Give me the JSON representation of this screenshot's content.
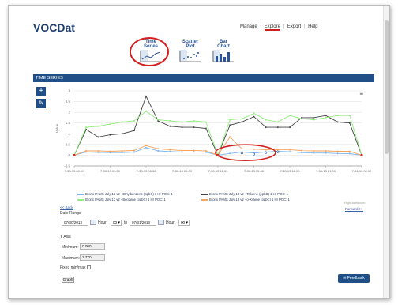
{
  "app": {
    "title": "VOCDat"
  },
  "nav": {
    "items": [
      {
        "label": "Manage",
        "active": false
      },
      {
        "label": "Explore",
        "active": true
      },
      {
        "label": "Export",
        "active": false
      },
      {
        "label": "Help",
        "active": false
      }
    ]
  },
  "views": [
    {
      "label_line1": "Time",
      "label_line2": "Series",
      "icon": "line-chart-icon",
      "selected": true
    },
    {
      "label_line1": "Scatter",
      "label_line2": "Plot",
      "icon": "scatter-plot-icon",
      "selected": false
    },
    {
      "label_line1": "Bar",
      "label_line2": "Chart",
      "icon": "bar-chart-icon",
      "selected": false
    }
  ],
  "section": {
    "title": "TIME SERIES"
  },
  "tools": {
    "add": "+",
    "edit": "✎",
    "menu": "≡"
  },
  "colors": {
    "navy": "#1f4f86",
    "highlight": "#d42020"
  },
  "chart_data": {
    "type": "line",
    "title": "",
    "xlabel": "",
    "ylabel": "Value",
    "ylim": [
      -0.5,
      3
    ],
    "yticks": [
      "3",
      "2.5",
      "2",
      "1.5",
      "1",
      "0.5",
      "0",
      "-0.5"
    ],
    "xticks": [
      "7-30-13 00:00",
      "7-30-13 03:00",
      "7-30-13 06:00",
      "7-30-13 09:00",
      "7-30-13 12:00",
      "7-30-13 15:00",
      "7-30-13 18:00",
      "7-30-13 21:00",
      "7-31-13 00:00"
    ],
    "xlim": [
      0,
      24
    ],
    "grid": true,
    "series": [
      {
        "name": "Bronx PAMS July 13 v2 - Ethylbenzene (ppbC) 1 Hr POC: 1",
        "color": "#7cb5ec",
        "points": [
          [
            0,
            0
          ],
          [
            1,
            0.15
          ],
          [
            2,
            0.13
          ],
          [
            3,
            0.12
          ],
          [
            4,
            0.12
          ],
          [
            5,
            0.14
          ],
          [
            6,
            0.35
          ],
          [
            7,
            0.2
          ],
          [
            8,
            0.17
          ],
          [
            9,
            0.15
          ],
          [
            10,
            0.15
          ],
          [
            11,
            0.14
          ],
          [
            12,
            0
          ],
          [
            13,
            0.08
          ],
          [
            14,
            0.15
          ],
          [
            15,
            0.1
          ],
          [
            16,
            0.15
          ],
          [
            17,
            0.18
          ],
          [
            18,
            0.16
          ],
          [
            19,
            0.12
          ],
          [
            20,
            0.1
          ],
          [
            21,
            0.1
          ],
          [
            22,
            0.08
          ],
          [
            23,
            0.07
          ],
          [
            24,
            0
          ]
        ]
      },
      {
        "name": "Bronx PAMS July 13 v2 - Toluene (ppbC) 1 Hr POC: 1",
        "color": "#434348",
        "points": [
          [
            0,
            0
          ],
          [
            1,
            1.2
          ],
          [
            2,
            0.85
          ],
          [
            3,
            0.95
          ],
          [
            4,
            1.0
          ],
          [
            5,
            1.15
          ],
          [
            6,
            2.75
          ],
          [
            7,
            1.6
          ],
          [
            8,
            1.35
          ],
          [
            9,
            1.3
          ],
          [
            10,
            1.3
          ],
          [
            11,
            1.25
          ],
          [
            12,
            0
          ],
          [
            13,
            1.4
          ],
          [
            14,
            1.55
          ],
          [
            15,
            1.8
          ],
          [
            16,
            1.3
          ],
          [
            17,
            1.3
          ],
          [
            18,
            1.3
          ],
          [
            19,
            1.75
          ],
          [
            20,
            1.75
          ],
          [
            21,
            1.85
          ],
          [
            22,
            1.55
          ],
          [
            23,
            1.5
          ],
          [
            24,
            0
          ]
        ]
      },
      {
        "name": "Bronx PAMS July 13 v2 - Benzene (ppbC) 1 Hr POC: 1",
        "color": "#90ed7d",
        "points": [
          [
            0,
            0
          ],
          [
            1,
            1.3
          ],
          [
            2,
            1.35
          ],
          [
            3,
            1.45
          ],
          [
            4,
            1.55
          ],
          [
            5,
            1.6
          ],
          [
            6,
            2.05
          ],
          [
            7,
            1.65
          ],
          [
            8,
            1.6
          ],
          [
            9,
            1.55
          ],
          [
            10,
            1.6
          ],
          [
            11,
            1.55
          ],
          [
            12,
            0
          ],
          [
            13,
            1.65
          ],
          [
            14,
            1.7
          ],
          [
            15,
            1.95
          ],
          [
            16,
            1.65
          ],
          [
            17,
            1.55
          ],
          [
            18,
            1.85
          ],
          [
            19,
            1.7
          ],
          [
            20,
            1.65
          ],
          [
            21,
            1.75
          ],
          [
            22,
            1.85
          ],
          [
            23,
            1.85
          ],
          [
            24,
            0
          ]
        ]
      },
      {
        "name": "Bronx PAMS July 13 v2 - o-Xylene (ppbC) 1 Hr POC: 1",
        "color": "#f7a35c",
        "points": [
          [
            0,
            0
          ],
          [
            1,
            0.2
          ],
          [
            2,
            0.2
          ],
          [
            3,
            0.18
          ],
          [
            4,
            0.2
          ],
          [
            5,
            0.22
          ],
          [
            6,
            0.45
          ],
          [
            7,
            0.3
          ],
          [
            8,
            0.25
          ],
          [
            9,
            0.22
          ],
          [
            10,
            0.22
          ],
          [
            11,
            0.2
          ],
          [
            12,
            0
          ],
          [
            13,
            0.85
          ],
          [
            14,
            0.3
          ],
          [
            15,
            0.28
          ],
          [
            16,
            0.25
          ],
          [
            17,
            0.25
          ],
          [
            18,
            0.25
          ],
          [
            19,
            0.22
          ],
          [
            20,
            0.2
          ],
          [
            21,
            0.2
          ],
          [
            22,
            0.18
          ],
          [
            23,
            0.18
          ],
          [
            24,
            0
          ]
        ]
      }
    ]
  },
  "links": {
    "back": "<< Back",
    "forward": "Forward >>",
    "credit": "Highcharts.com"
  },
  "date_range": {
    "label": "Date Range",
    "from": "07/30/2013",
    "hour_label": "Hour:",
    "from_hour": "00",
    "to_label": "to",
    "to": "07/31/2013",
    "to_hour": "00"
  },
  "y_axis": {
    "label": "Y Axis",
    "min_label": "Minimum:",
    "min_value": "0.000",
    "max_label": "Maximum:",
    "max_value": "2.770",
    "fixed_label": "Fixed min/max"
  },
  "buttons": {
    "graph": "Graph",
    "feedback": "Feedback"
  }
}
